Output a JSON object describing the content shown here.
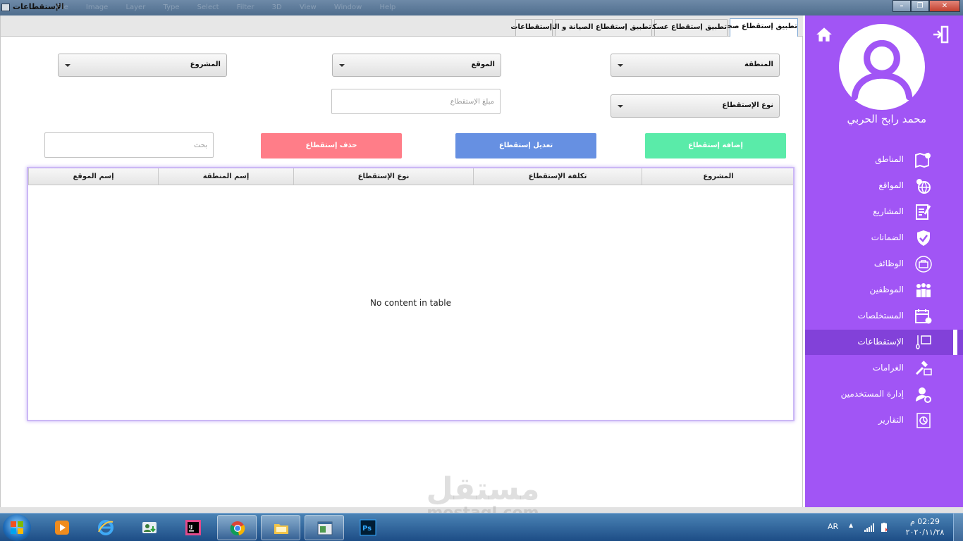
{
  "window": {
    "title": "الإستقطاعات",
    "menu_items": [
      "File",
      "Image",
      "Layer",
      "Type",
      "Select",
      "Filter",
      "3D",
      "View",
      "Window",
      "Help"
    ]
  },
  "tabs": [
    {
      "label": "تطبيق إستقطاع صحي",
      "active": true
    },
    {
      "label": "تطبيق إستقطاع عسكري",
      "active": false
    },
    {
      "label": "تطبيق إستقطاع الصيانة و النظافة",
      "active": false
    },
    {
      "label": "إستقطاعات",
      "active": false
    }
  ],
  "form": {
    "region_combo": "المنطقة",
    "location_combo": "الموقع",
    "project_combo": "المشروع",
    "deduction_type_combo": "نوع الإستقطاع",
    "amount_placeholder": "مبلغ الإستقطاع",
    "search_placeholder": "بحث"
  },
  "buttons": {
    "add": "إضافة إستقطاع",
    "edit": "تعديل إستقطاع",
    "delete": "حذف إستقطاع"
  },
  "table": {
    "columns": [
      "المشروع",
      "تكلفة الإستقطاع",
      "نوع الإستقطاع",
      "إسم المنطقة",
      "إسم الموقع"
    ],
    "rows": [],
    "empty_message": "No content in table"
  },
  "sidebar": {
    "user_name": "محمد رابح الحربي",
    "items": [
      {
        "label": "المناطق",
        "icon": "map-icon"
      },
      {
        "label": "المواقع",
        "icon": "globe-location-icon"
      },
      {
        "label": "المشاريع",
        "icon": "project-document-icon"
      },
      {
        "label": "الضمانات",
        "icon": "shield-check-icon"
      },
      {
        "label": "الوظائف",
        "icon": "briefcase-icon"
      },
      {
        "label": "الموظفين",
        "icon": "employees-icon"
      },
      {
        "label": "المستخلصات",
        "icon": "calendar-icon"
      },
      {
        "label": "الإستقطاعات",
        "icon": "deductions-icon",
        "active": true
      },
      {
        "label": "الغرامات",
        "icon": "gavel-icon"
      },
      {
        "label": "إدارة المستخدمين",
        "icon": "user-settings-icon"
      },
      {
        "label": "التقارير",
        "icon": "reports-icon"
      }
    ]
  },
  "taskbar": {
    "language": "AR",
    "time": "02:29 م",
    "date": "٢٠٢٠/١١/٢٨",
    "apps": [
      "media-player-icon",
      "internet-explorer-icon",
      "contacts-icon",
      "intellij-icon",
      "chrome-icon",
      "file-explorer-icon",
      "app-window-icon",
      "photoshop-icon"
    ]
  },
  "watermark": {
    "arabic": "مستقل",
    "latin": "mostaql.com"
  },
  "colors": {
    "sidebar": "#a155f5",
    "sidebar_active": "#8241d9",
    "add_button": "#5aeba9",
    "edit_button": "#6690e2",
    "delete_button": "#ff7d88"
  }
}
